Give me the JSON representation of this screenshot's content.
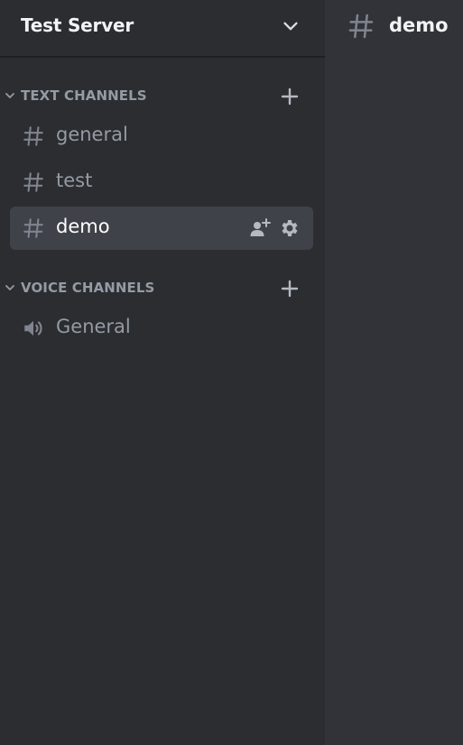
{
  "server": {
    "name": "Test Server"
  },
  "categories": [
    {
      "label": "TEXT CHANNELS"
    },
    {
      "label": "VOICE CHANNELS"
    }
  ],
  "channels": [
    {
      "label": "general",
      "type": "text",
      "selected": false
    },
    {
      "label": "test",
      "type": "text",
      "selected": false
    },
    {
      "label": "demo",
      "type": "text",
      "selected": true
    },
    {
      "label": "General",
      "type": "voice",
      "selected": false
    }
  ],
  "topbar": {
    "title": "demo",
    "icon": "hash-icon"
  },
  "colors": {
    "sidebar_bg": "#2b2d31",
    "main_bg": "#313338",
    "selected_bg": "#404249",
    "muted_text": "#949ba4",
    "bright_text": "#f2f3f5"
  }
}
